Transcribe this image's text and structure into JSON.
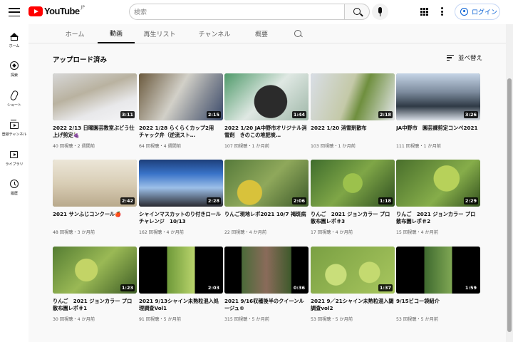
{
  "masthead": {
    "logo_text": "YouTube",
    "logo_region": "JP",
    "search_placeholder": "検索",
    "login_label": "ログイン"
  },
  "sidebar": {
    "items": [
      {
        "label": "ホーム",
        "icon": "home-icon"
      },
      {
        "label": "探索",
        "icon": "explore-icon"
      },
      {
        "label": "ショート",
        "icon": "shorts-icon"
      },
      {
        "label": "登録チャンネル",
        "icon": "subscriptions-icon"
      },
      {
        "label": "ライブラリ",
        "icon": "library-icon"
      },
      {
        "label": "履歴",
        "icon": "history-icon"
      }
    ]
  },
  "tabs": [
    {
      "label": "ホーム",
      "active": false
    },
    {
      "label": "動画",
      "active": true
    },
    {
      "label": "再生リスト",
      "active": false
    },
    {
      "label": "チャンネル",
      "active": false
    },
    {
      "label": "概要",
      "active": false
    }
  ],
  "section": {
    "title": "アップロード済み",
    "sort_label": "並べ替え"
  },
  "videos": [
    {
      "title": "2022 2/13 日曜園芸教室ぶどう仕上げ剪定🍇",
      "meta": "40 回視聴・2 週間前",
      "duration": "3:11"
    },
    {
      "title": "2022 1/28 らくらくカップ2用　チャック弁（逆流スト…",
      "meta": "64 回視聴・4 週間前",
      "duration": "2:15"
    },
    {
      "title": "2022 1/20 JA中野市オリジナル消雪剤　きのこの堆肥炭…",
      "meta": "107 回視聴・1 か月前",
      "duration": "1:44"
    },
    {
      "title": "2022 1/20 消雪剤散布",
      "meta": "103 回視聴・1 か月前",
      "duration": "2:18"
    },
    {
      "title": "JA中野市　園芸課剪定コンペ2021",
      "meta": "111 回視聴・1 か月前",
      "duration": "3:26"
    },
    {
      "title": "2021 サンふじコンクール🍎",
      "meta": "48 回視聴・3 か月前",
      "duration": "2:42"
    },
    {
      "title": "シャインマスカットのり付きロール　チャレンジ　10/13",
      "meta": "162 回視聴・4 か月前",
      "duration": "2:28"
    },
    {
      "title": "りんご現地レポ2021 10/7 褐斑病",
      "meta": "22 回視聴・4 か月前",
      "duration": "2:06"
    },
    {
      "title": "りんご　2021 ジョンカラー プロ散布園レポ＃3",
      "meta": "17 回視聴・4 か月前",
      "duration": "1:18"
    },
    {
      "title": "りんご　2021 ジョンカラー プロ散布園レポ＃2",
      "meta": "15 回視聴・4 か月前",
      "duration": "2:29"
    },
    {
      "title": "りんご　2021 ジョンカラー プロ散布園レポ＃1",
      "meta": "30 回視聴・4 か月前",
      "duration": "1:23"
    },
    {
      "title": "2021 9/13シャイン未熟粒混入処理調査Vol1",
      "meta": "91 回視聴・5 か月前",
      "duration": "2:03"
    },
    {
      "title": "2021 9/16収穫後半のクイーンルージュ®",
      "meta": "315 回視聴・5 か月前",
      "duration": "0:36"
    },
    {
      "title": "2021 9／21シャイン未熟粒混入閾調査vol2",
      "meta": "53 回視聴・5 か月前",
      "duration": "1:37"
    },
    {
      "title": "9/15ビコー袋紹介",
      "meta": "53 回視聴・5 か月前",
      "duration": "1:59"
    }
  ],
  "colors": {
    "brand": "#ff0000",
    "link": "#065fd4",
    "background": "#f9f9f9"
  }
}
